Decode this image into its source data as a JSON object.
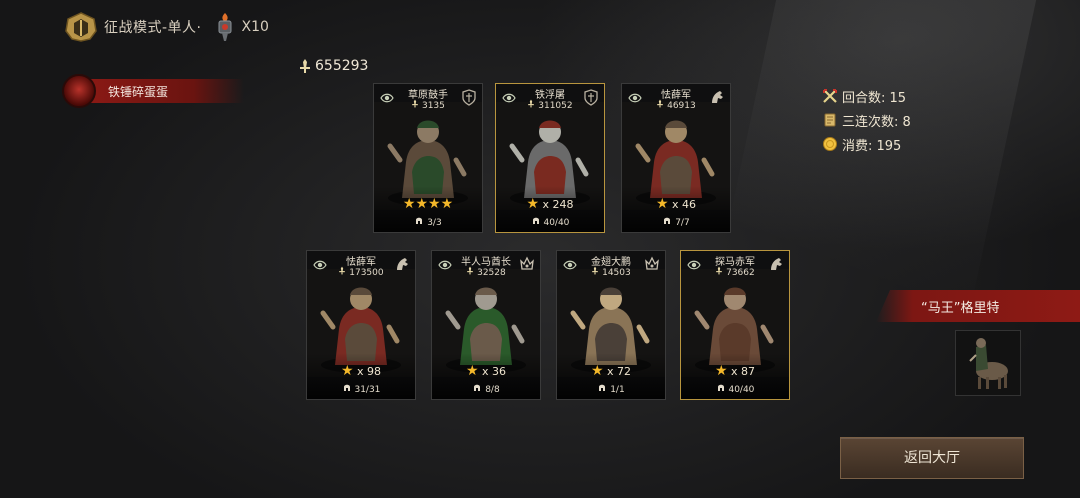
{
  "header": {
    "mode_label": "征战模式-单人·",
    "count_label": "X10"
  },
  "player": {
    "name": "铁锤碎蛋蛋"
  },
  "power_total": "655293",
  "units": [
    {
      "name": "草原鼓手",
      "power": "3135",
      "stars": 4,
      "stars_text": "",
      "troops": "3/3",
      "frame": "normal",
      "crest": "shield-crest-icon",
      "palette": [
        "#5b4a3a",
        "#2a4a2a",
        "#8c7a64"
      ]
    },
    {
      "name": "铁浮屠",
      "power": "311052",
      "stars": 1,
      "stars_text": "x 248",
      "troops": "40/40",
      "frame": "gold",
      "crest": "shield-crest-icon",
      "palette": [
        "#6a6a6a",
        "#7a2a20",
        "#b0b0a8"
      ]
    },
    {
      "name": "怯薛军",
      "power": "46913",
      "stars": 1,
      "stars_text": "x 46",
      "troops": "7/7",
      "frame": "normal",
      "crest": "horse-crest-icon",
      "palette": [
        "#7a2a22",
        "#5a4a3a",
        "#a08866"
      ]
    },
    {
      "name": "怯薛军",
      "power": "173500",
      "stars": 1,
      "stars_text": "x 98",
      "troops": "31/31",
      "frame": "normal",
      "crest": "horse-crest-icon",
      "palette": [
        "#7a2a22",
        "#5a4a3a",
        "#a08866"
      ]
    },
    {
      "name": "半人马酋长",
      "power": "32528",
      "stars": 1,
      "stars_text": "x 36",
      "troops": "8/8",
      "frame": "normal",
      "crest": "crown-crest-icon",
      "palette": [
        "#2a5a2a",
        "#6a5a4a",
        "#a09a90"
      ]
    },
    {
      "name": "金翅大鹏",
      "power": "14503",
      "stars": 1,
      "stars_text": "x 72",
      "troops": "1/1",
      "frame": "normal",
      "crest": "crown-crest-icon",
      "palette": [
        "#8a7456",
        "#4a4038",
        "#c0a880"
      ]
    },
    {
      "name": "探马赤军",
      "power": "73662",
      "stars": 1,
      "stars_text": "x 87",
      "troops": "40/40",
      "frame": "gold",
      "crest": "horse-crest-icon",
      "palette": [
        "#6a4a38",
        "#5a3a2a",
        "#a08870"
      ]
    }
  ],
  "stats": {
    "rounds": "回合数: 15",
    "combos": "三连次数: 8",
    "cost": "消费: 195"
  },
  "boss": {
    "name": "“马王”格里特"
  },
  "buttons": {
    "return_label": "返回大厅"
  }
}
